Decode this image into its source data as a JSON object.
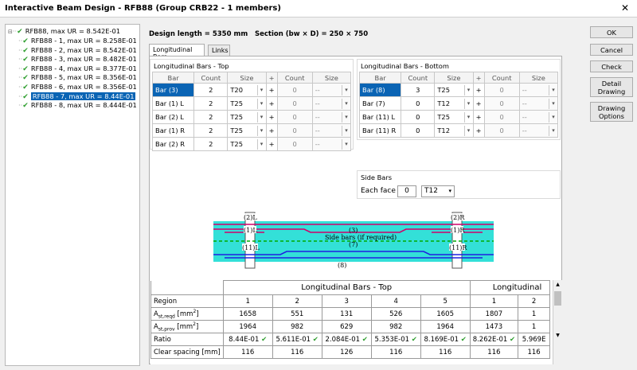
{
  "window": {
    "title": "Interactive Beam Design - RFB88 (Group CRB22 - 1 members)",
    "close": "✕"
  },
  "tree": {
    "root": "RFB88, max UR = 8.542E-01",
    "items": [
      "RFB88 - 1, max UR = 8.258E-01",
      "RFB88 - 2, max UR = 8.542E-01",
      "RFB88 - 3, max UR = 8.482E-01",
      "RFB88 - 4, max UR = 8.377E-01",
      "RFB88 - 5, max UR = 8.356E-01",
      "RFB88 - 6, max UR = 8.356E-01",
      "RFB88 - 7, max UR = 8.44E-01",
      "RFB88 - 8, max UR = 8.444E-01"
    ],
    "selected_index": 6
  },
  "buttons": {
    "ok": "OK",
    "cancel": "Cancel",
    "check": "Check",
    "detail": "Detail Drawing",
    "options": "Drawing Options"
  },
  "header": {
    "design_length": "Design length = 5350 mm",
    "section": "Section (bw × D) = 250 × 750"
  },
  "tabs": [
    "Longitudinal Bars",
    "Links"
  ],
  "top_group": {
    "title": "Longitudinal Bars - Top",
    "headers": [
      "Bar",
      "Count",
      "Size",
      "+",
      "Count",
      "Size"
    ],
    "rows": [
      {
        "bar": "Bar (3)",
        "count": "2",
        "size": "T20",
        "plus": "+",
        "count2": "0",
        "size2": "--"
      },
      {
        "bar": "Bar (1) L",
        "count": "2",
        "size": "T25",
        "plus": "+",
        "count2": "0",
        "size2": "--"
      },
      {
        "bar": "Bar (2) L",
        "count": "2",
        "size": "T25",
        "plus": "+",
        "count2": "0",
        "size2": "--"
      },
      {
        "bar": "Bar (1) R",
        "count": "2",
        "size": "T25",
        "plus": "+",
        "count2": "0",
        "size2": "--"
      },
      {
        "bar": "Bar (2) R",
        "count": "2",
        "size": "T25",
        "plus": "+",
        "count2": "0",
        "size2": "--"
      }
    ]
  },
  "bottom_group": {
    "title": "Longitudinal Bars - Bottom",
    "headers": [
      "Bar",
      "Count",
      "Size",
      "+",
      "Count",
      "Size"
    ],
    "rows": [
      {
        "bar": "Bar (8)",
        "count": "3",
        "size": "T25",
        "plus": "+",
        "count2": "0",
        "size2": "--"
      },
      {
        "bar": "Bar (7)",
        "count": "0",
        "size": "T12",
        "plus": "+",
        "count2": "0",
        "size2": "--"
      },
      {
        "bar": "Bar (11) L",
        "count": "0",
        "size": "T25",
        "plus": "+",
        "count2": "0",
        "size2": "--"
      },
      {
        "bar": "Bar (11) R",
        "count": "0",
        "size": "T12",
        "plus": "+",
        "count2": "0",
        "size2": "--"
      }
    ]
  },
  "side_bars": {
    "title": "Side Bars",
    "label": "Each face",
    "count": "0",
    "size": "T12"
  },
  "drawing": {
    "labels": {
      "l2": "(2)L",
      "l1": "(1)L",
      "l11": "(11)L",
      "r2": "(2)R",
      "r1": "(1)R",
      "r11": "(11)R",
      "b3": "(3)",
      "side": "Side bars (if required)",
      "b7": "(7)",
      "b8": "(8)"
    },
    "colors": {
      "concrete": "#33e0d8",
      "top": "#d0006a",
      "bottom": "#2020e0",
      "side": "#00aa00"
    }
  },
  "results": {
    "group_top": "Longitudinal Bars - Top",
    "group_bottom": "Longitudinal",
    "rows": [
      {
        "label": "Region",
        "cells": [
          "1",
          "2",
          "3",
          "4",
          "5",
          "1",
          "2"
        ]
      },
      {
        "label": "Ast,reqd [mm²]",
        "cells": [
          "1658",
          "551",
          "131",
          "526",
          "1605",
          "1807",
          "1"
        ]
      },
      {
        "label": "Ast,prov [mm²]",
        "cells": [
          "1964",
          "982",
          "629",
          "982",
          "1964",
          "1473",
          "1"
        ]
      },
      {
        "label": "Ratio",
        "cells": [
          "8.44E-01",
          "5.611E-01",
          "2.084E-01",
          "5.353E-01",
          "8.169E-01",
          "8.262E-01",
          "5.969E"
        ]
      },
      {
        "label": "Clear spacing [mm]",
        "cells": [
          "116",
          "116",
          "126",
          "116",
          "116",
          "116",
          "116"
        ]
      }
    ]
  }
}
